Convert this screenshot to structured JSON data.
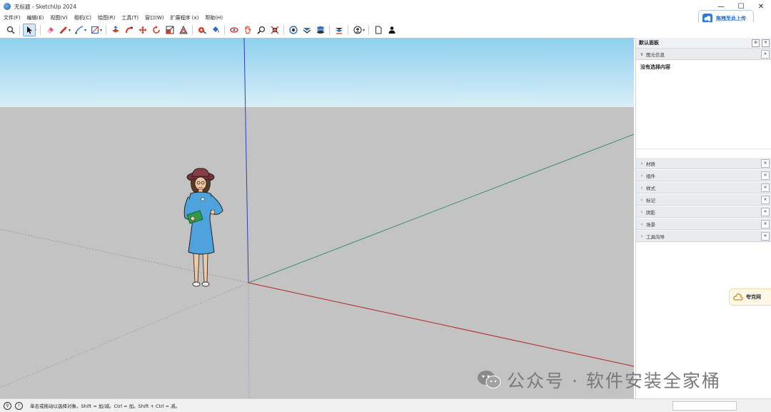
{
  "window": {
    "title": "无标题 - SketchUp 2024",
    "controls": [
      "—",
      "☐",
      "✕"
    ]
  },
  "cloud_upload": {
    "label": "拖拽至此上传"
  },
  "menu": [
    "文件(F)",
    "编辑(E)",
    "视图(V)",
    "相机(C)",
    "绘图(R)",
    "工具(T)",
    "窗口(W)",
    "扩展程序 (x)",
    "帮助(H)"
  ],
  "toolbar": {
    "icons": [
      "search-icon",
      "select-arrow-icon",
      "eraser-icon",
      "pencil-icon",
      "line-icon",
      "rectangle-icon",
      "push-pull-icon",
      "follow-me-icon",
      "move-icon",
      "rotate-icon",
      "scale-icon",
      "offset-icon",
      "tape-measure-icon",
      "paint-bucket-icon",
      "orbit-icon",
      "pan-icon",
      "zoom-icon",
      "zoom-extents-icon",
      "warehouse-icon",
      "extension-icon",
      "layers-icon",
      "styles-icon",
      "account-icon",
      "new-doc-icon",
      "user-icon"
    ]
  },
  "panel": {
    "title": "默认面板",
    "entity_info": {
      "label": "图元信息",
      "body": "没有选择内容"
    },
    "trays": [
      "材质",
      "组件",
      "样式",
      "标记",
      "阴影",
      "场景",
      "工具向导"
    ]
  },
  "side_widget": {
    "text": "夸克网"
  },
  "status": {
    "text": "单击或拖动以选择对象。Shift = 加/减。Ctrl = 加。Shift + Ctrl = 减。"
  },
  "watermark": {
    "text": "公众号 · 软件安装全家桶"
  },
  "colors": {
    "sky_top": "#8fd0ee",
    "sky_bottom": "#d8eef8",
    "ground": "#c3c3c3",
    "axis_red": "#b22222",
    "axis_green": "#2e8b57",
    "axis_blue": "#2d3fb8"
  }
}
